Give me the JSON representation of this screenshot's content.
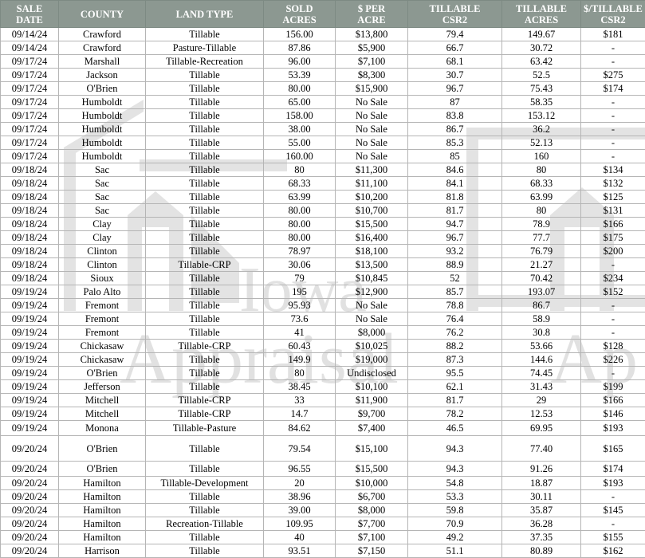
{
  "watermark": {
    "line1": "Iowa",
    "line2": "Appraisal",
    "line3": "Ap"
  },
  "table": {
    "headers": [
      "SALE DATE",
      "COUNTY",
      "LAND TYPE",
      "SOLD\nACRES",
      "$ PER\nACRE",
      "TILLABLE\nCSR2",
      "TILLABLE\nACRES",
      "$/TILLABLE\nCSR2"
    ],
    "rows": [
      [
        "09/14/24",
        "Crawford",
        "Tillable",
        "156.00",
        "$13,800",
        "79.4",
        "149.67",
        "$181"
      ],
      [
        "09/14/24",
        "Crawford",
        "Pasture-Tillable",
        "87.86",
        "$5,900",
        "66.7",
        "30.72",
        "-"
      ],
      [
        "09/17/24",
        "Marshall",
        "Tillable-Recreation",
        "96.00",
        "$7,100",
        "68.1",
        "63.42",
        "-"
      ],
      [
        "09/17/24",
        "Jackson",
        "Tillable",
        "53.39",
        "$8,300",
        "30.7",
        "52.5",
        "$275"
      ],
      [
        "09/17/24",
        "O'Brien",
        "Tillable",
        "80.00",
        "$15,900",
        "96.7",
        "75.43",
        "$174"
      ],
      [
        "09/17/24",
        "Humboldt",
        "Tillable",
        "65.00",
        "No Sale",
        "87",
        "58.35",
        "-"
      ],
      [
        "09/17/24",
        "Humboldt",
        "Tillable",
        "158.00",
        "No Sale",
        "83.8",
        "153.12",
        "-"
      ],
      [
        "09/17/24",
        "Humboldt",
        "Tillable",
        "38.00",
        "No Sale",
        "86.7",
        "36.2",
        "-"
      ],
      [
        "09/17/24",
        "Humboldt",
        "Tillable",
        "55.00",
        "No Sale",
        "85.3",
        "52.13",
        "-"
      ],
      [
        "09/17/24",
        "Humboldt",
        "Tillable",
        "160.00",
        "No Sale",
        "85",
        "160",
        "-"
      ],
      [
        "09/18/24",
        "Sac",
        "Tillable",
        "80",
        "$11,300",
        "84.6",
        "80",
        "$134"
      ],
      [
        "09/18/24",
        "Sac",
        "Tillable",
        "68.33",
        "$11,100",
        "84.1",
        "68.33",
        "$132"
      ],
      [
        "09/18/24",
        "Sac",
        "Tillable",
        "63.99",
        "$10,200",
        "81.8",
        "63.99",
        "$125"
      ],
      [
        "09/18/24",
        "Sac",
        "Tillable",
        "80.00",
        "$10,700",
        "81.7",
        "80",
        "$131"
      ],
      [
        "09/18/24",
        "Clay",
        "Tillable",
        "80.00",
        "$15,500",
        "94.7",
        "78.9",
        "$166"
      ],
      [
        "09/18/24",
        "Clay",
        "Tillable",
        "80.00",
        "$16,400",
        "96.7",
        "77.7",
        "$175"
      ],
      [
        "09/18/24",
        "Clinton",
        "Tillable",
        "78.97",
        "$18,100",
        "93.2",
        "76.79",
        "$200"
      ],
      [
        "09/18/24",
        "Clinton",
        "Tillable-CRP",
        "30.06",
        "$13,500",
        "88.9",
        "21.27",
        "-"
      ],
      [
        "09/18/24",
        "Sioux",
        "Tillable",
        "79",
        "$10,845",
        "52",
        "70.42",
        "$234"
      ],
      [
        "09/19/24",
        "Palo Alto",
        "Tillable",
        "195",
        "$12,900",
        "85.7",
        "193.07",
        "$152"
      ],
      [
        "09/19/24",
        "Fremont",
        "Tillable",
        "95.93",
        "No Sale",
        "78.8",
        "86.7",
        "-"
      ],
      [
        "09/19/24",
        "Fremont",
        "Tillable",
        "73.6",
        "No Sale",
        "76.4",
        "58.9",
        "-"
      ],
      [
        "09/19/24",
        "Fremont",
        "Tillable",
        "41",
        "$8,000",
        "76.2",
        "30.8",
        "-"
      ],
      [
        "09/19/24",
        "Chickasaw",
        "Tillable-CRP",
        "60.43",
        "$10,025",
        "88.2",
        "53.66",
        "$128"
      ],
      [
        "09/19/24",
        "Chickasaw",
        "Tillable",
        "149.9",
        "$19,000",
        "87.3",
        "144.6",
        "$226"
      ],
      [
        "09/19/24",
        "O'Brien",
        "Tillable",
        "80",
        "Undisclosed",
        "95.5",
        "74.45",
        "-"
      ],
      [
        "09/19/24",
        "Jefferson",
        "Tillable",
        "38.45",
        "$10,100",
        "62.1",
        "31.43",
        "$199"
      ],
      [
        "09/19/24",
        "Mitchell",
        "Tillable-CRP",
        "33",
        "$11,900",
        "81.7",
        "29",
        "$166"
      ],
      [
        "09/19/24",
        "Mitchell",
        "Tillable-CRP",
        "14.7",
        "$9,700",
        "78.2",
        "12.53",
        "$146"
      ],
      [
        "09/19/24",
        "Monona",
        "Tillable-Pasture",
        "84.62",
        "$7,400",
        "46.5",
        "69.95",
        "$193"
      ],
      [
        "09/20/24",
        "O'Brien",
        "Tillable",
        "79.54",
        "$15,100",
        "94.3",
        "77.40",
        "$165"
      ],
      [
        "09/20/24",
        "O'Brien",
        "Tillable",
        "96.55",
        "$15,500",
        "94.3",
        "91.26",
        "$174"
      ],
      [
        "09/20/24",
        "Hamilton",
        "Tillable-Development",
        "20",
        "$10,000",
        "54.8",
        "18.87",
        "$193"
      ],
      [
        "09/20/24",
        "Hamilton",
        "Tillable",
        "38.96",
        "$6,700",
        "53.3",
        "30.11",
        "-"
      ],
      [
        "09/20/24",
        "Hamilton",
        "Tillable",
        "39.00",
        "$8,000",
        "59.8",
        "35.87",
        "$145"
      ],
      [
        "09/20/24",
        "Hamilton",
        "Recreation-Tillable",
        "109.95",
        "$7,700",
        "70.9",
        "36.28",
        "-"
      ],
      [
        "09/20/24",
        "Hamilton",
        "Tillable",
        "40",
        "$7,100",
        "49.2",
        "37.35",
        "$155"
      ],
      [
        "09/20/24",
        "Harrison",
        "Tillable",
        "93.51",
        "$7,150",
        "51.1",
        "80.89",
        "$162"
      ]
    ]
  }
}
